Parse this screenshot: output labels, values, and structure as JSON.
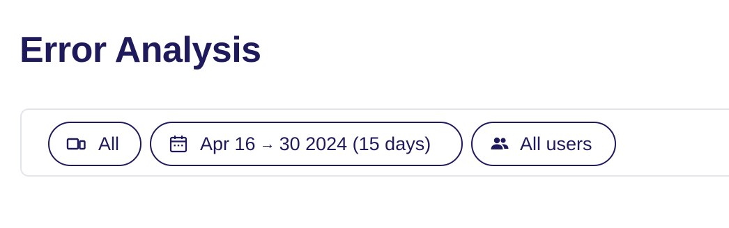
{
  "page": {
    "title": "Error Analysis"
  },
  "filters": {
    "device": {
      "icon": "devices-icon",
      "label": "All"
    },
    "date_range": {
      "icon": "calendar-icon",
      "start": "Apr 16",
      "arrow": "→",
      "end": "30 2024 (15 days)"
    },
    "users": {
      "icon": "users-icon",
      "label": "All users"
    }
  },
  "colors": {
    "text": "#1f1a5c",
    "border": "#e2e5ec",
    "background": "#ffffff"
  }
}
